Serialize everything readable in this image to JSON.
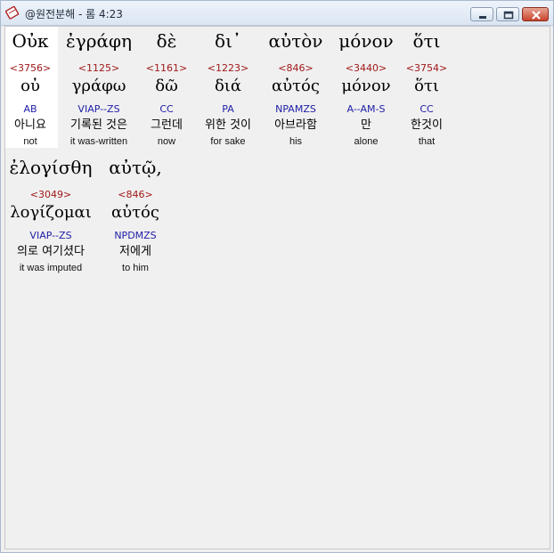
{
  "window": {
    "title": "@원전분해 - 롬 4:23"
  },
  "colors": {
    "strong_number": "#a01818",
    "parsing": "#2020a8",
    "background": "#f0f0f0",
    "selected": "#ffffff"
  },
  "icons": {
    "app": "bible-app-icon",
    "minimize": "minimize-icon",
    "maximize": "maximize-icon",
    "close": "close-icon"
  },
  "words": [
    {
      "greek": "Οὐκ",
      "strong": "<3756>",
      "lemma": "οὐ",
      "parse": "AB",
      "korean": "아니요",
      "english": "not"
    },
    {
      "greek": "ἐγράφη",
      "strong": "<1125>",
      "lemma": "γράφω",
      "parse": "VIAP--ZS",
      "korean": "기록된 것은",
      "english": "it was-written"
    },
    {
      "greek": "δὲ",
      "strong": "<1161>",
      "lemma": "δῶ",
      "parse": "CC",
      "korean": "그런데",
      "english": "now"
    },
    {
      "greek": "δι᾽",
      "strong": "<1223>",
      "lemma": "διά",
      "parse": "PA",
      "korean": "위한 것이",
      "english": "for sake"
    },
    {
      "greek": "αὐτὸν",
      "strong": "<846>",
      "lemma": "αὐτός",
      "parse": "NPAMZS",
      "korean": "아브라함",
      "english": "his"
    },
    {
      "greek": "μόνον",
      "strong": "<3440>",
      "lemma": "μόνον",
      "parse": "A--AM-S",
      "korean": "만",
      "english": "alone"
    },
    {
      "greek": "ὅτι",
      "strong": "<3754>",
      "lemma": "ὅτι",
      "parse": "CC",
      "korean": "한것이",
      "english": "that"
    },
    {
      "greek": "ἐλογίσθη",
      "strong": "<3049>",
      "lemma": "λογίζομαι",
      "parse": "VIAP--ZS",
      "korean": "의로 여기셨다",
      "english": "it was imputed"
    },
    {
      "greek": "αὐτῷ,",
      "strong": "<846>",
      "lemma": "αὐτός",
      "parse": "NPDMZS",
      "korean": "저에게",
      "english": "to him"
    }
  ]
}
